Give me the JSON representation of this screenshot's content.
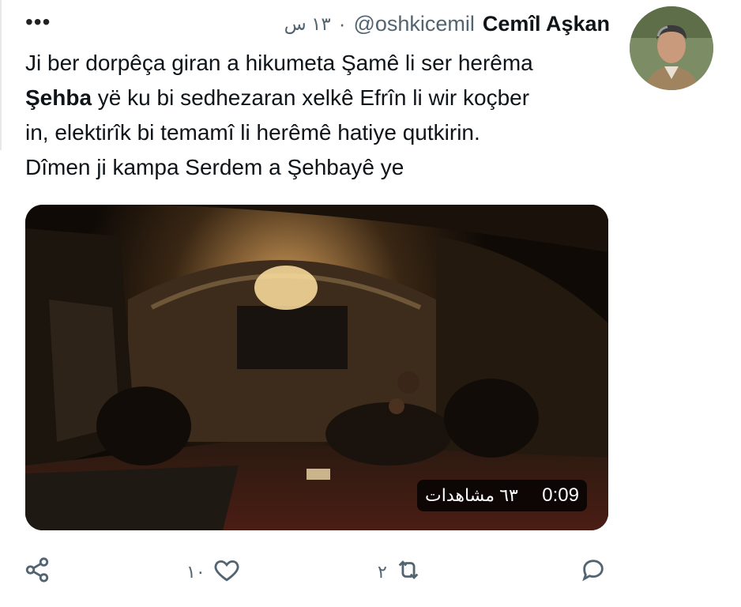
{
  "tweet": {
    "author_name": "Cemîl Aşkan",
    "handle": "@oshkicemil",
    "separator": "·",
    "time": "١٣ س",
    "text_line1": "Ji ber dorpêça giran a hikumeta Şamê li ser herêma",
    "text_bold": "Şehba",
    "text_line2_rest": " yë ku bi sedhezaran xelkê Efrîn li wir koçber",
    "text_line3": "in, elektirîk bi temamî li herêmê hatiye qutkirin.",
    "text_line4": "Dîmen ji kampa Serdem a Şehbayê ye"
  },
  "video": {
    "views": "٦٣ مشاهدات",
    "duration": "0:09"
  },
  "actions": {
    "reply_count": "",
    "retweet_count": "٢",
    "like_count": "١٠",
    "share_count": ""
  },
  "icons": [
    "more-icon",
    "reply-icon",
    "retweet-icon",
    "like-icon",
    "share-icon"
  ],
  "colors": {
    "text": "#0f1419",
    "secondary": "#536471",
    "overlay": "#000000"
  }
}
